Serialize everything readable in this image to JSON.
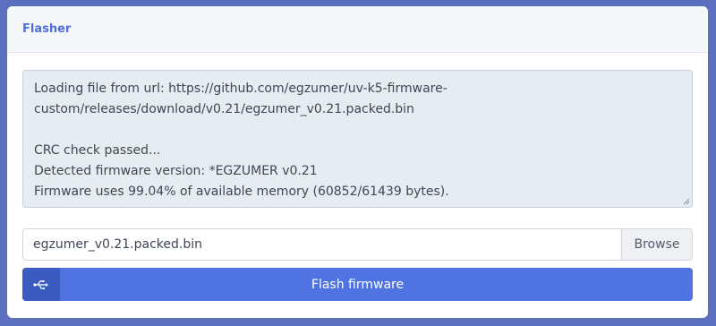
{
  "card": {
    "title": "Flasher"
  },
  "log": {
    "lines": [
      "Loading file from url: https://github.com/egzumer/uv-k5-firmware-",
      "custom/releases/download/v0.21/egzumer_v0.21.packed.bin",
      "",
      "CRC check passed...",
      "Detected firmware version: *EGZUMER v0.21",
      "Firmware uses 99.04% of available memory (60852/61439 bytes)."
    ]
  },
  "file_input": {
    "value": "egzumer_v0.21.packed.bin",
    "browse_label": "Browse"
  },
  "flash_button": {
    "label": "Flash firmware",
    "icon": "usb-icon"
  },
  "colors": {
    "accent": "#4f74e1",
    "accent_dark": "#3c5bc0",
    "background": "#5b6fbf",
    "title": "#4f70db"
  }
}
